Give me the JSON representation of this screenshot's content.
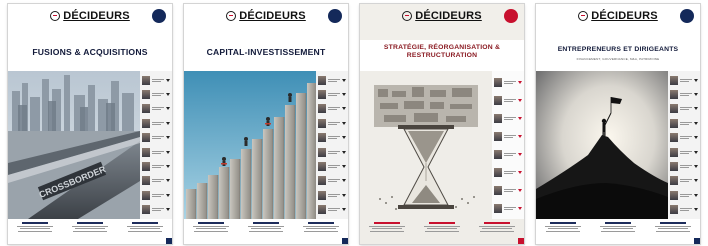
{
  "covers": [
    {
      "logo": "DÉCIDEURS",
      "title": "FUSIONS & ACQUISITIONS",
      "subtitle": "",
      "badge_color": "#14295a",
      "accent": "#1e2d5c"
    },
    {
      "logo": "DÉCIDEURS",
      "title": "CAPITAL-INVESTISSEMENT",
      "subtitle": "",
      "badge_color": "#14295a",
      "accent": "#1e2d5c"
    },
    {
      "logo": "DÉCIDEURS",
      "title": "STRATÉGIE, RÉORGANISATION & RESTRUCTURATION",
      "subtitle": "",
      "badge_color": "#c8102e",
      "accent": "#c8102e"
    },
    {
      "logo": "DÉCIDEURS",
      "title": "ENTREPRENEURS ET DIRIGEANTS",
      "subtitle": "FINANCEMENT, GOUVERNANCE, M&A, PATRIMOINE",
      "badge_color": "#14295a",
      "accent": "#1e2d5c"
    }
  ],
  "art": {
    "cover1_sign": "CROSSBORDER"
  }
}
